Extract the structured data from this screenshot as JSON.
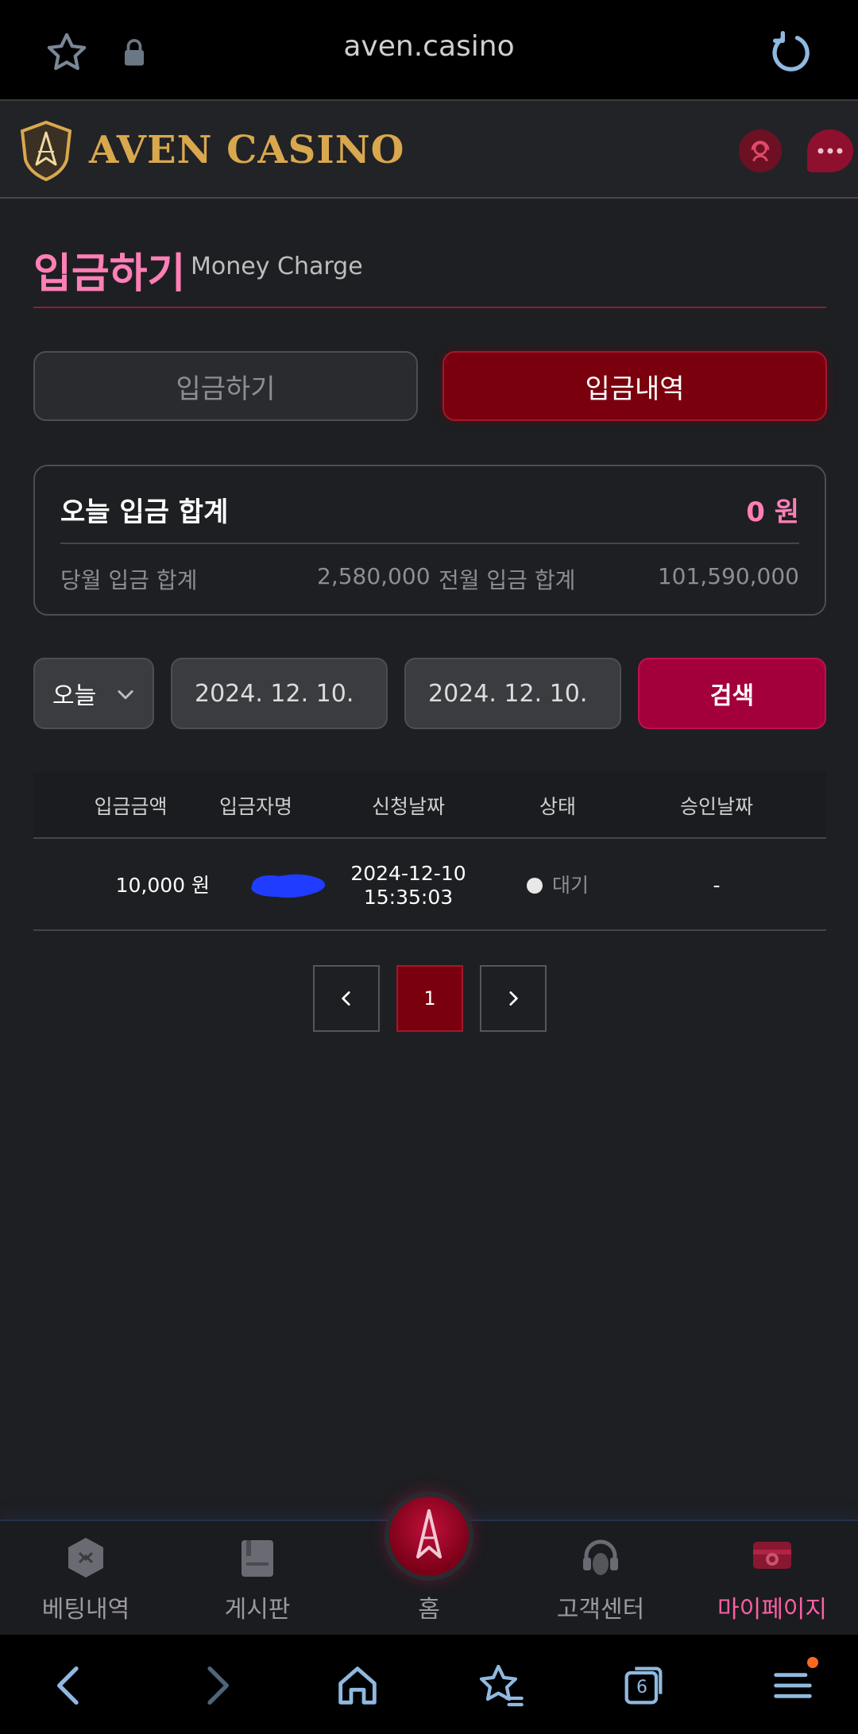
{
  "browser": {
    "url": "aven.casino",
    "tab_count": "6"
  },
  "header": {
    "logo_text": "AVEN CASINO"
  },
  "page": {
    "title": "입금하기",
    "subtitle": "Money Charge"
  },
  "tabs": [
    {
      "label": "입금하기",
      "active": false
    },
    {
      "label": "입금내역",
      "active": true
    }
  ],
  "summary": {
    "today_label": "오늘 입금 합계",
    "today_value": "0 원",
    "month_label": "당월 입금 합계",
    "month_value": "2,580,000",
    "prev_label": "전월 입금 합계",
    "prev_value": "101,590,000"
  },
  "filter": {
    "period": "오늘",
    "date_from": "2024. 12. 10.",
    "date_to": "2024. 12. 10.",
    "search_label": "검색"
  },
  "table": {
    "columns": [
      "입금금액",
      "입금자명",
      "신청날짜",
      "상태",
      "승인날짜"
    ],
    "rows": [
      {
        "amount": "10,000 원",
        "date": "2024-12-10",
        "time": "15:35:03",
        "status": "대기",
        "approved": "-"
      }
    ]
  },
  "pagination": {
    "current": "1"
  },
  "bottom_nav": [
    {
      "label": "베팅내역",
      "icon": "betting-history-icon"
    },
    {
      "label": "게시판",
      "icon": "board-icon"
    },
    {
      "label": "홈",
      "icon": "home-logo-icon"
    },
    {
      "label": "고객센터",
      "icon": "headset-icon"
    },
    {
      "label": "마이페이지",
      "icon": "mypage-icon",
      "active": true
    }
  ],
  "colors": {
    "accent_pink": "#ff7fb6",
    "active_tab": "#7a000e",
    "search_button": "#a3003b",
    "logo_gold": "#d9a84e"
  }
}
